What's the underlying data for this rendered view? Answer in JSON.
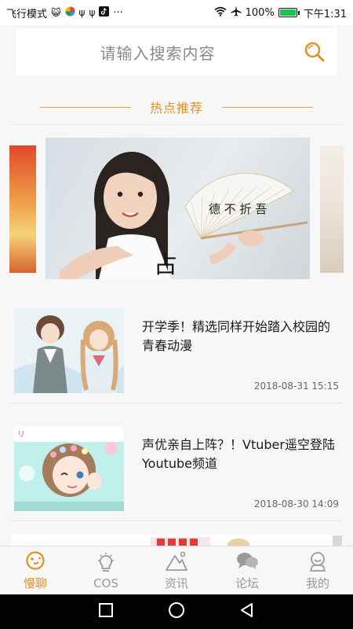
{
  "status_bar": {
    "airplane_mode": "飞行模式",
    "battery_percent": "100%",
    "time": "下午1:31",
    "more": "···"
  },
  "search": {
    "placeholder": "请输入搜索内容",
    "icon": "search-icon"
  },
  "hot_section": {
    "title": "热点推荐"
  },
  "articles": [
    {
      "title": "开学季！精选同样开始踏入校园的青春动漫",
      "time": "2018-08-31 15:15"
    },
    {
      "title": "声优亲自上阵？！Vtuber遥空登陆Youtube频道",
      "time": "2018-08-30 14:09"
    }
  ],
  "tabs": [
    {
      "label": "慢聊",
      "icon": "chat-bubble-icon",
      "active": true
    },
    {
      "label": "COS",
      "icon": "lightbulb-icon",
      "active": false
    },
    {
      "label": "资讯",
      "icon": "mountain-icon",
      "active": false
    },
    {
      "label": "论坛",
      "icon": "speech-bubbles-icon",
      "active": false
    },
    {
      "label": "我的",
      "icon": "profile-icon",
      "active": false
    }
  ],
  "colors": {
    "accent": "#e0922a",
    "inactive_tab": "#9a9a9a",
    "battery_fill": "#19c24a"
  }
}
